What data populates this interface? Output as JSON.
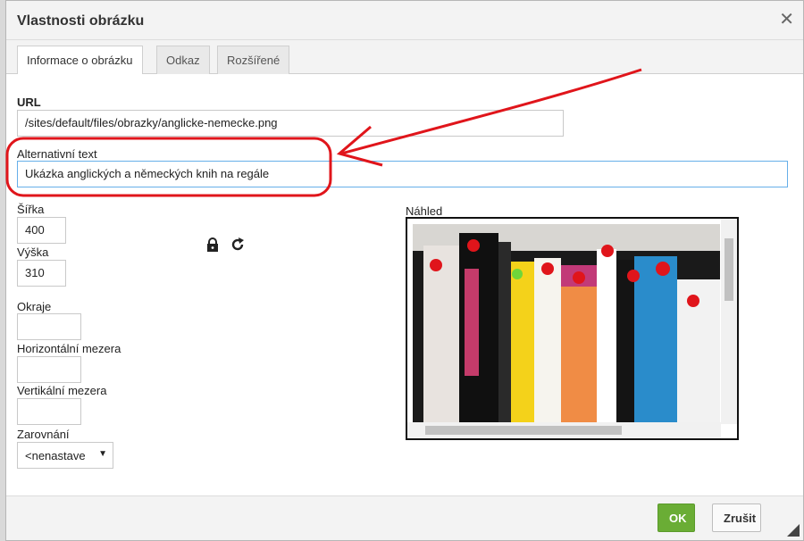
{
  "dialog": {
    "title": "Vlastnosti obrázku",
    "close_icon": "close-icon"
  },
  "tabs": [
    {
      "label": "Informace o obrázku",
      "active": true
    },
    {
      "label": "Odkaz",
      "active": false
    },
    {
      "label": "Rozšířené",
      "active": false
    }
  ],
  "form": {
    "url_label": "URL",
    "url_value": "/sites/default/files/obrazky/anglicke-nemecke.png",
    "alt_label": "Alternativní text",
    "alt_value": "Ukázka anglických a německých knih na regále",
    "width_label": "Šířka",
    "width_value": "400",
    "height_label": "Výška",
    "height_value": "310",
    "border_label": "Okraje",
    "border_value": "",
    "hspace_label": "Horizontální mezera",
    "hspace_value": "",
    "vspace_label": "Vertikální mezera",
    "vspace_value": "",
    "align_label": "Zarovnání",
    "align_value": "<nenastave"
  },
  "icons": {
    "lock": "lock-icon",
    "reset": "reset-size-icon"
  },
  "preview": {
    "label": "Náhled"
  },
  "footer": {
    "ok_label": "OK",
    "cancel_label": "Zrušit"
  },
  "colors": {
    "ok_button": "#6aad35",
    "annotation": "#e0151b",
    "focus_border": "#66afe9"
  }
}
